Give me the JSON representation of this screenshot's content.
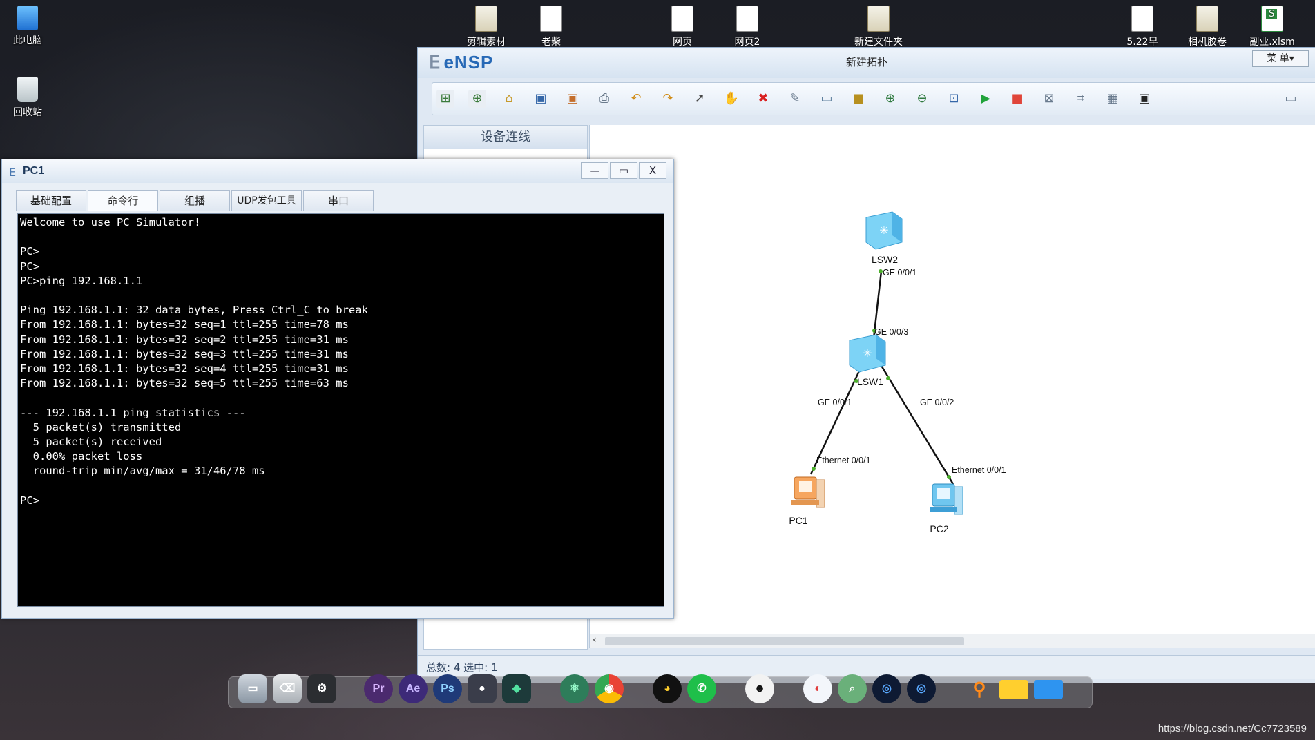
{
  "desktop": {
    "left_icons": [
      {
        "label": "此电脑",
        "icon": "computer-icon"
      },
      {
        "label": "回收站",
        "icon": "recycle-bin-icon"
      }
    ],
    "top_icons": [
      {
        "label": "剪辑素材",
        "icon": "folder-icon"
      },
      {
        "label": "老柴",
        "icon": "file-icon"
      },
      {
        "label": "网页",
        "icon": "file-icon"
      },
      {
        "label": "网页2",
        "icon": "file-icon"
      },
      {
        "label": "新建文件夹",
        "icon": "folder-icon"
      },
      {
        "label": "5.22早",
        "icon": "file-icon"
      },
      {
        "label": "相机胶卷",
        "icon": "folder-icon"
      },
      {
        "label": "副业.xlsm",
        "icon": "spreadsheet-icon"
      }
    ]
  },
  "ensp": {
    "logo": "eNSP",
    "window_title": "新建拓扑",
    "menu_label": "菜 单▾",
    "left_panel_title": "设备连线",
    "status_text": "总数: 4  选中: 1",
    "toolbar_icons": [
      "new-topology-icon",
      "new-lab-icon",
      "open-icon",
      "save-icon",
      "save-as-icon",
      "print-icon",
      "undo-icon",
      "redo-icon",
      "select-icon",
      "hand-icon",
      "delete-icon",
      "remove-link-icon",
      "text-icon",
      "rectangle-icon",
      "zoom-in-icon",
      "zoom-out-icon",
      "fit-icon",
      "start-device-icon",
      "stop-device-icon",
      "capture-icon",
      "topology-icon",
      "grid-icon",
      "screenshot-icon"
    ],
    "topology": {
      "devices": [
        {
          "id": "LSW2",
          "label": "LSW2",
          "kind": "switch"
        },
        {
          "id": "LSW1",
          "label": "LSW1",
          "kind": "switch"
        },
        {
          "id": "PC1",
          "label": "PC1",
          "kind": "pc"
        },
        {
          "id": "PC2",
          "label": "PC2",
          "kind": "pc"
        }
      ],
      "links": [
        {
          "from": "LSW2",
          "to": "LSW1",
          "from_port": "GE 0/0/1",
          "to_port": "GE 0/0/3"
        },
        {
          "from": "LSW1",
          "to": "PC1",
          "from_port": "GE 0/0/1",
          "to_port": "Ethernet 0/0/1"
        },
        {
          "from": "LSW1",
          "to": "PC2",
          "from_port": "GE 0/0/2",
          "to_port": "Ethernet 0/0/1"
        }
      ]
    }
  },
  "pc1": {
    "title": "PC1",
    "buttons": {
      "minimize": "—",
      "maximize": "▭",
      "close": "X"
    },
    "tabs": [
      "基础配置",
      "命令行",
      "组播",
      "UDP发包工具",
      "串口"
    ],
    "active_tab": "命令行",
    "console_lines": [
      "Welcome to use PC Simulator!",
      "",
      "PC>",
      "PC>",
      "PC>ping 192.168.1.1",
      "",
      "Ping 192.168.1.1: 32 data bytes, Press Ctrl_C to break",
      "From 192.168.1.1: bytes=32 seq=1 ttl=255 time=78 ms",
      "From 192.168.1.1: bytes=32 seq=2 ttl=255 time=31 ms",
      "From 192.168.1.1: bytes=32 seq=3 ttl=255 time=31 ms",
      "From 192.168.1.1: bytes=32 seq=4 ttl=255 time=31 ms",
      "From 192.168.1.1: bytes=32 seq=5 ttl=255 time=63 ms",
      "",
      "--- 192.168.1.1 ping statistics ---",
      "  5 packet(s) transmitted",
      "  5 packet(s) received",
      "  0.00% packet loss",
      "  round-trip min/avg/max = 31/46/78 ms",
      "",
      "PC>"
    ]
  },
  "dock": {
    "items": [
      {
        "icon": "finder-icon"
      },
      {
        "icon": "trash-icon"
      },
      {
        "icon": "system-settings-icon"
      },
      {
        "icon": "premiere-icon",
        "label": "Pr"
      },
      {
        "icon": "after-effects-icon",
        "label": "Ae"
      },
      {
        "icon": "photoshop-icon",
        "label": "Ps"
      },
      {
        "icon": "app-icon"
      },
      {
        "icon": "editor-icon"
      },
      {
        "icon": "atom-icon"
      },
      {
        "icon": "chrome-icon"
      },
      {
        "icon": "qq-icon"
      },
      {
        "icon": "wechat-icon"
      },
      {
        "icon": "panda-icon"
      },
      {
        "icon": "browser-icon"
      },
      {
        "icon": "search-tool-icon"
      },
      {
        "icon": "camera-icon"
      },
      {
        "icon": "camera2-icon"
      },
      {
        "icon": "magnifier-icon"
      },
      {
        "icon": "yellow-folder-icon"
      },
      {
        "icon": "blue-folder-icon"
      }
    ]
  },
  "watermark": "https://blog.csdn.net/Cc7723589"
}
